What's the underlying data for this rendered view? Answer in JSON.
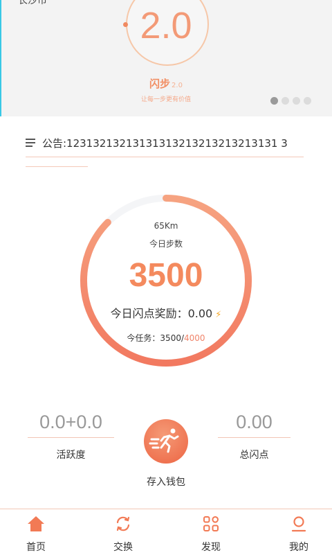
{
  "banner": {
    "corner_text": "长沙市",
    "version": "2.0",
    "brand": "闪步",
    "brand_version": "2.0",
    "slogan": "让每一步更有价值",
    "page_count": 4,
    "active_page": 1
  },
  "notice": {
    "text": "公告:12313213213131313213213213213131 3"
  },
  "ring": {
    "distance": "65Km",
    "steps_label": "今日步数",
    "steps": "3500",
    "reward_text": "今日闪点奖励：0.00",
    "task_label": "今任务：3500/",
    "task_goal": "4000",
    "progress": 0.875,
    "color": "#f48a5e"
  },
  "stats": {
    "activity_value": "0.0+0.0",
    "activity_label": "活跃度",
    "points_value": "0.00",
    "points_label": "总闪点",
    "deposit_label": "存入钱包"
  },
  "tabs": [
    {
      "label": "首页",
      "icon": "home-icon",
      "active": true
    },
    {
      "label": "交换",
      "icon": "exchange-icon",
      "active": false
    },
    {
      "label": "发现",
      "icon": "grid-icon",
      "active": false
    },
    {
      "label": "我的",
      "icon": "user-icon",
      "active": false
    }
  ],
  "colors": {
    "accent": "#f48a5e",
    "accent_light": "#f6b59a"
  }
}
